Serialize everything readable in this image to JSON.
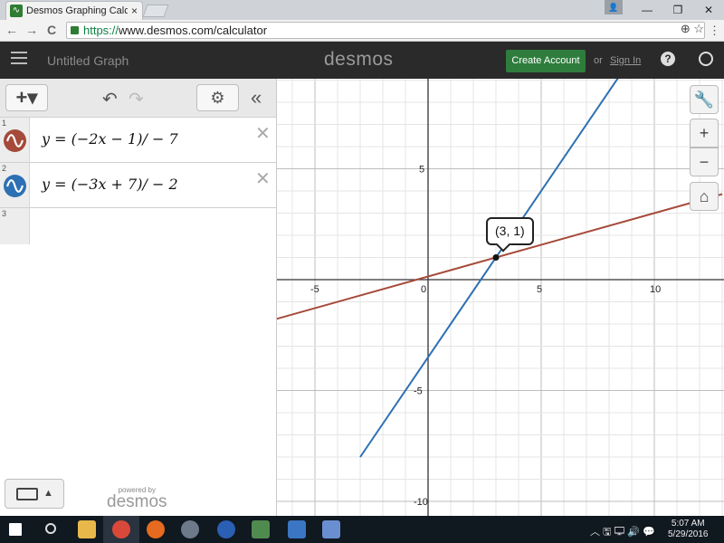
{
  "browser": {
    "tab_title": "Desmos Graphing Calculator",
    "tab_close": "×",
    "window_controls": {
      "minimize": "—",
      "restore": "❐",
      "close": "✕"
    },
    "nav": {
      "back": "←",
      "forward": "→",
      "reload": "C"
    },
    "address": {
      "scheme": "https://",
      "rest": "www.desmos.com/calculator"
    },
    "omni_icons": "⊕ ☆",
    "menu": "⋮"
  },
  "header": {
    "graph_title": "Untitled Graph",
    "logo": "desmos",
    "create_account": "Create Account",
    "or": "or",
    "sign_in": "Sign In",
    "help": "?"
  },
  "expression_panel": {
    "add_label": "+▾",
    "undo": "↶",
    "redo": "↷",
    "settings": "⚙",
    "collapse": "«",
    "expressions": [
      {
        "index": "1",
        "latex": "y = (−2x − 1)/ − 7",
        "color": "#a54a3a",
        "delete": "✕"
      },
      {
        "index": "2",
        "latex": "y = (−3x + 7)/ − 2",
        "color": "#2d70b3",
        "delete": "✕"
      }
    ],
    "empty_index": "3",
    "keyboard_caret": "▲",
    "powered_by": "powered by",
    "powered_logo": "desmos"
  },
  "graph": {
    "controls": {
      "wrench": "🔧",
      "zoom_in": "+",
      "zoom_out": "−",
      "home": "⌂"
    },
    "point_label": "(3, 1)",
    "x_ticks": [
      "-5",
      "0",
      "5",
      "10"
    ],
    "y_ticks": [
      "5",
      "-5",
      "-10"
    ],
    "line_colors": {
      "red": "#a54a3a",
      "blue": "#2d70b3"
    }
  },
  "taskbar": {
    "time": "5:07 AM",
    "date": "5/29/2016",
    "tray": "︿ 🖫 🖵 🔊 💬"
  }
}
